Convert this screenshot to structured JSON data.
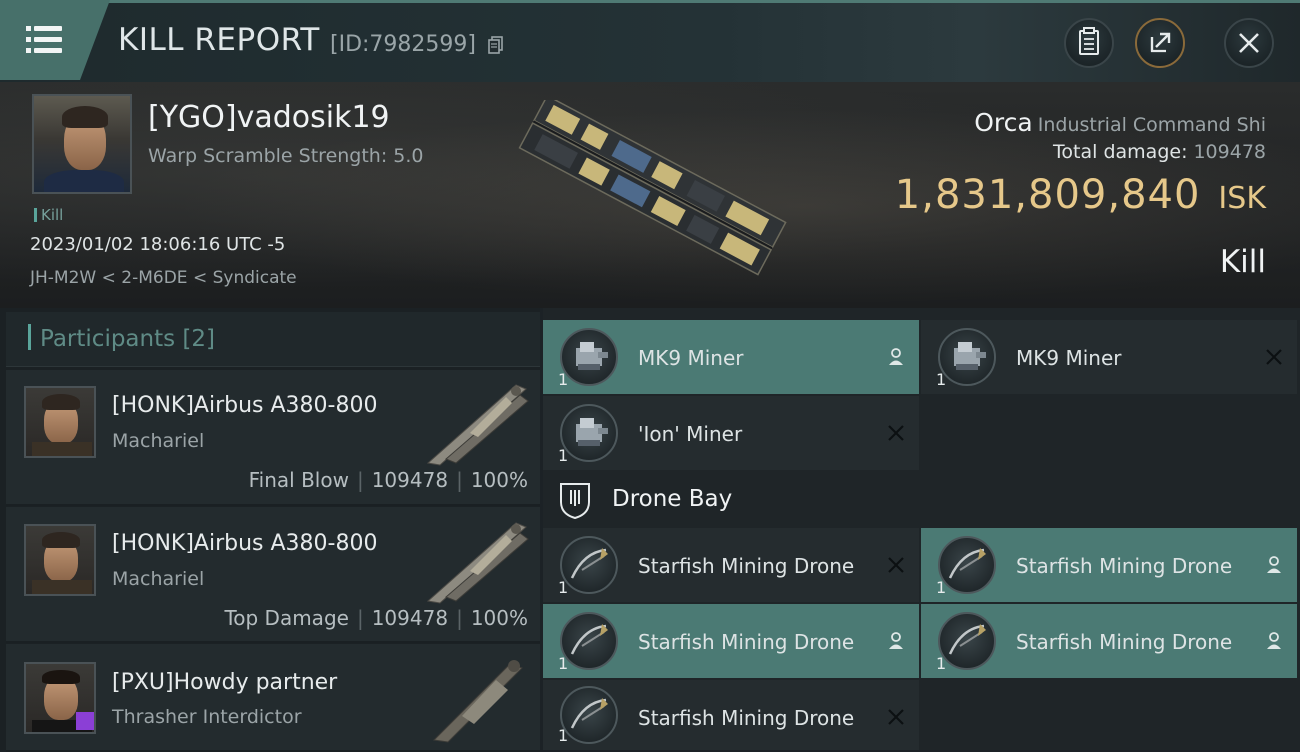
{
  "header": {
    "title": "KILL REPORT",
    "report_id": "[ID:7982599]"
  },
  "victim": {
    "name": "[YGO]vadosik19",
    "warp_scramble": "Warp Scramble Strength: 5.0",
    "kill_tag": "Kill",
    "datetime": "2023/01/02 18:06:16 UTC -5",
    "location": "JH-M2W < 2-M6DE < Syndicate",
    "ship_name": "Orca",
    "ship_class": "Industrial Command Shi",
    "total_damage_label": "Total damage:",
    "total_damage": "109478",
    "isk_value": "1,831,809,840",
    "isk_unit": "ISK",
    "result": "Kill"
  },
  "participants": {
    "title": "Participants",
    "count": "[2]",
    "rows": [
      {
        "name": "[HONK]Airbus A380-800",
        "ship": "Machariel",
        "role": "Final Blow",
        "damage": "109478",
        "percent": "100%"
      },
      {
        "name": "[HONK]Airbus A380-800",
        "ship": "Machariel",
        "role": "Top Damage",
        "damage": "109478",
        "percent": "100%"
      },
      {
        "name": "[PXU]Howdy partner",
        "ship": "Thrasher Interdictor"
      }
    ]
  },
  "modules": {
    "mining_slots": [
      {
        "label": "MK9 Miner",
        "qty": "1",
        "state": "teal"
      },
      {
        "label": "MK9 Miner",
        "qty": "1",
        "state": "dark"
      },
      {
        "label": "'Ion' Miner",
        "qty": "1",
        "state": "dark"
      }
    ],
    "drone_section": "Drone Bay",
    "drones": [
      {
        "label": "Starfish Mining Drone",
        "qty": "1",
        "state": "dark"
      },
      {
        "label": "Starfish Mining Drone",
        "qty": "1",
        "state": "teal"
      },
      {
        "label": "Starfish Mining Drone",
        "qty": "1",
        "state": "teal"
      },
      {
        "label": "Starfish Mining Drone",
        "qty": "1",
        "state": "teal"
      },
      {
        "label": "Starfish Mining Drone",
        "qty": "1",
        "state": "dark"
      }
    ]
  },
  "colors": {
    "accent_teal": "#4b7a74",
    "isk_gold": "#e6c88a",
    "header_tab": "#47706a"
  }
}
